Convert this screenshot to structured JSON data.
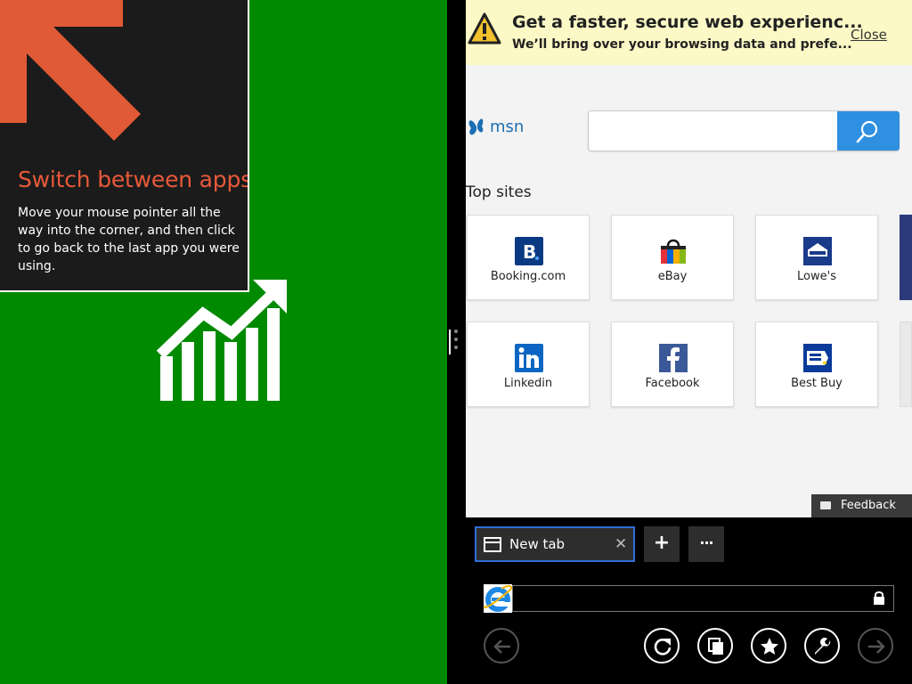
{
  "left_app": {
    "tip": {
      "title": "Switch between apps",
      "body": "Move your mouse pointer all the way into the corner, and then click to go back to the last app you were using."
    }
  },
  "browser": {
    "notification": {
      "title": "Get a faster, secure web experienc...",
      "subtitle": "We’ll bring over your browsing data and prefe...",
      "close_label": "Close"
    },
    "msn_label": "msn",
    "search": {
      "value": "",
      "placeholder": ""
    },
    "top_sites_title": "Top sites",
    "tiles": [
      {
        "label": "Booking.com",
        "icon": "booking-icon"
      },
      {
        "label": "eBay",
        "icon": "ebay-bag-icon"
      },
      {
        "label": "Lowe's",
        "icon": "lowes-icon"
      },
      {
        "label": "Linkedin",
        "icon": "linkedin-icon"
      },
      {
        "label": "Facebook",
        "icon": "facebook-icon"
      },
      {
        "label": "Best Buy",
        "icon": "best-buy-icon"
      }
    ],
    "feedback_label": "Feedback",
    "app_bar": {
      "tab_label": "New tab",
      "tab_close": "✕",
      "new_tab_glyph": "+",
      "more_glyph": "···",
      "address_value": ""
    }
  },
  "colors": {
    "finance_green": "#008a00",
    "tip_title": "#e8593a",
    "notification_bg": "#fcf9c6",
    "accent_blue": "#2f8fe0"
  }
}
